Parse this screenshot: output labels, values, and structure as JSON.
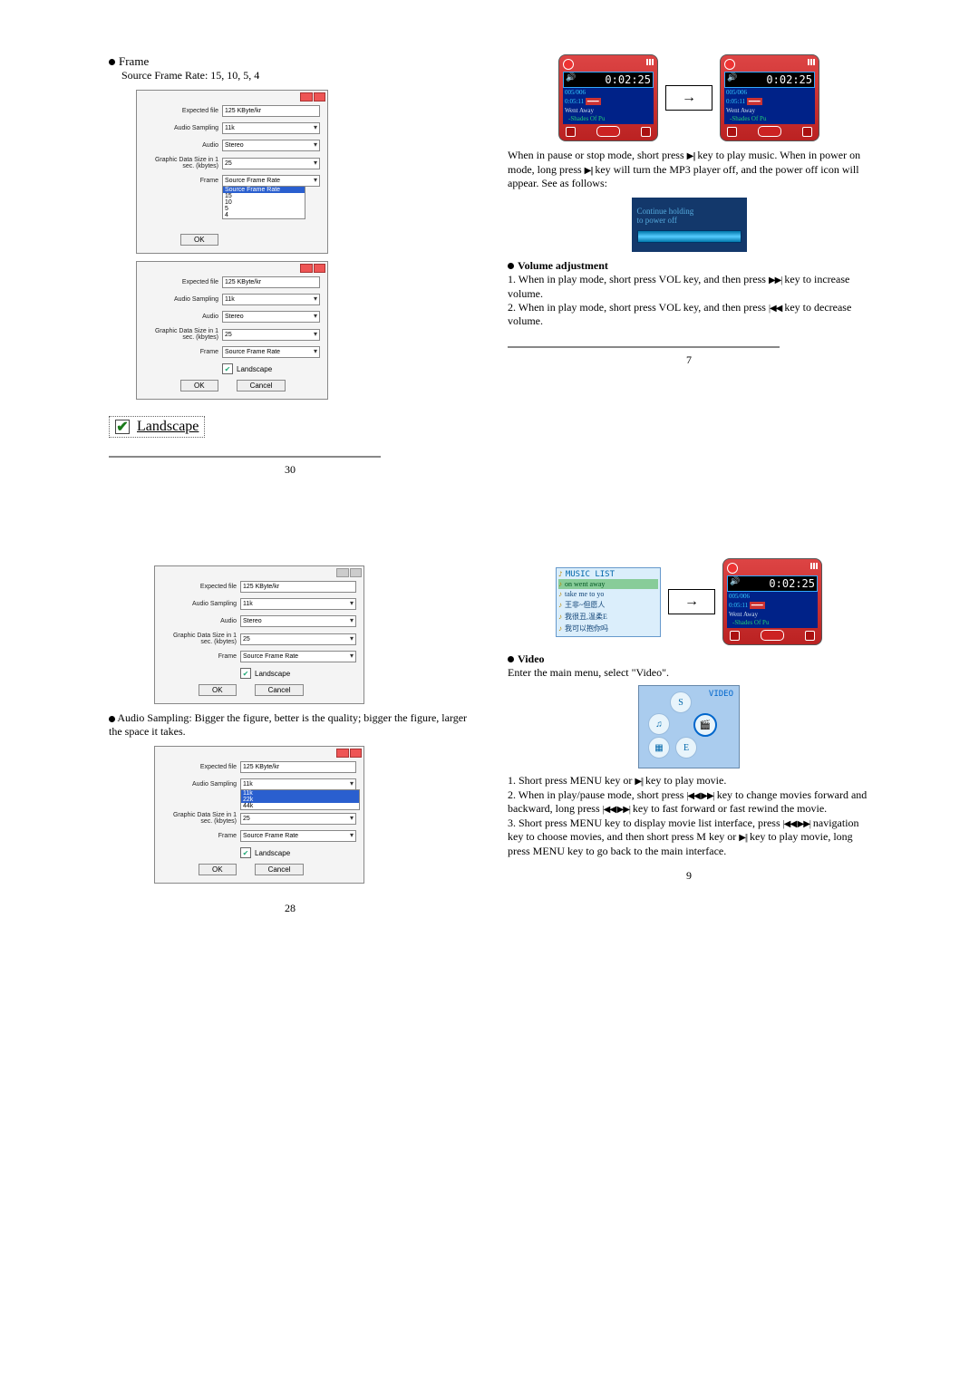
{
  "page30": {
    "head": "Frame",
    "subline": "Source Frame Rate: 15, 10, 5, 4",
    "dialog": {
      "labels": {
        "expected_file": "Expected file",
        "audio_sampling": "Audio Sampling",
        "audio": "Audio",
        "graphic": "Graphic Data Size in 1 sec. (kbytes)",
        "frame": "Frame"
      },
      "values": {
        "expected_file": "125 KByte/kr",
        "audio_sampling": "11k",
        "audio": "Stereo",
        "graphic": "25",
        "frame": "Source Frame Rate"
      },
      "frame_options": [
        "Source Frame Rate",
        "15",
        "10",
        "5",
        "4"
      ],
      "landscape": "Landscape",
      "ok": "OK",
      "cancel": "Cancel"
    },
    "landscape_big": "Landscape",
    "pagenum": "30"
  },
  "page7": {
    "player": {
      "time": "0:02:25",
      "track": "005/006",
      "total": "0:05:11",
      "title": "Went Away",
      "subtitle": "-Shades Of Pu"
    },
    "para1_a": "When in pause or stop mode, short press ",
    "para1_b": " key to play music. When in power on mode, long press ",
    "para1_c": " key will turn the MP3 player off, and the power off icon will appear. See as follows:",
    "poweroff": {
      "l1": "Continue holding",
      "l2": "to power off"
    },
    "vol_head": "Volume adjustment",
    "vol1_a": "1.  When in play mode, short press VOL key, and then press ",
    "vol1_b": " key to increase volume.",
    "vol2_a": "2.  When in play mode, short press VOL key, and then press ",
    "vol2_b": " key to decrease volume.",
    "pagenum": "7"
  },
  "page28": {
    "dialog_top": {
      "expected_file": "125 KByte/kr",
      "audio_sampling": "11k",
      "audio": "Stereo",
      "graphic": "25",
      "frame": "Source Frame Rate"
    },
    "para": "Audio Sampling: Bigger the figure, better is the quality; bigger the figure, larger the space it takes.",
    "dialog_bot": {
      "audio_options": [
        "11k",
        "22k",
        "44k"
      ]
    },
    "pagenum": "28"
  },
  "page9": {
    "music_list": {
      "title": "MUSIC LIST",
      "rows": [
        "on went away",
        "take me to yo",
        "王非~但愿人",
        "我很丑,温柔E",
        "我可以抱你吗"
      ]
    },
    "video_head": "Video",
    "video_intro": "Enter the main menu, select \"Video\".",
    "video_label": "VIDEO",
    "steps": {
      "s1_a": "1. Short press MENU key or ",
      "s1_b": " key to play movie.",
      "s2_a": "2. When in play/pause mode, short press ",
      "s2_b": " key to change movies forward and backward, long press ",
      "s2_c": " key to  fast forward or fast rewind the movie.",
      "s3_a": "3. Short press MENU key to display movie list interface, press ",
      "s3_b": " navigation key to choose movies, and then short press M key or ",
      "s3_c": " key to play movie, long press MENU key to go back to the main interface."
    },
    "pagenum": "9"
  },
  "icons": {
    "play_pause": "▶||",
    "ffwd": "▶▶|",
    "rew": "|◀◀",
    "both": "|◀◀ ▶▶|"
  }
}
